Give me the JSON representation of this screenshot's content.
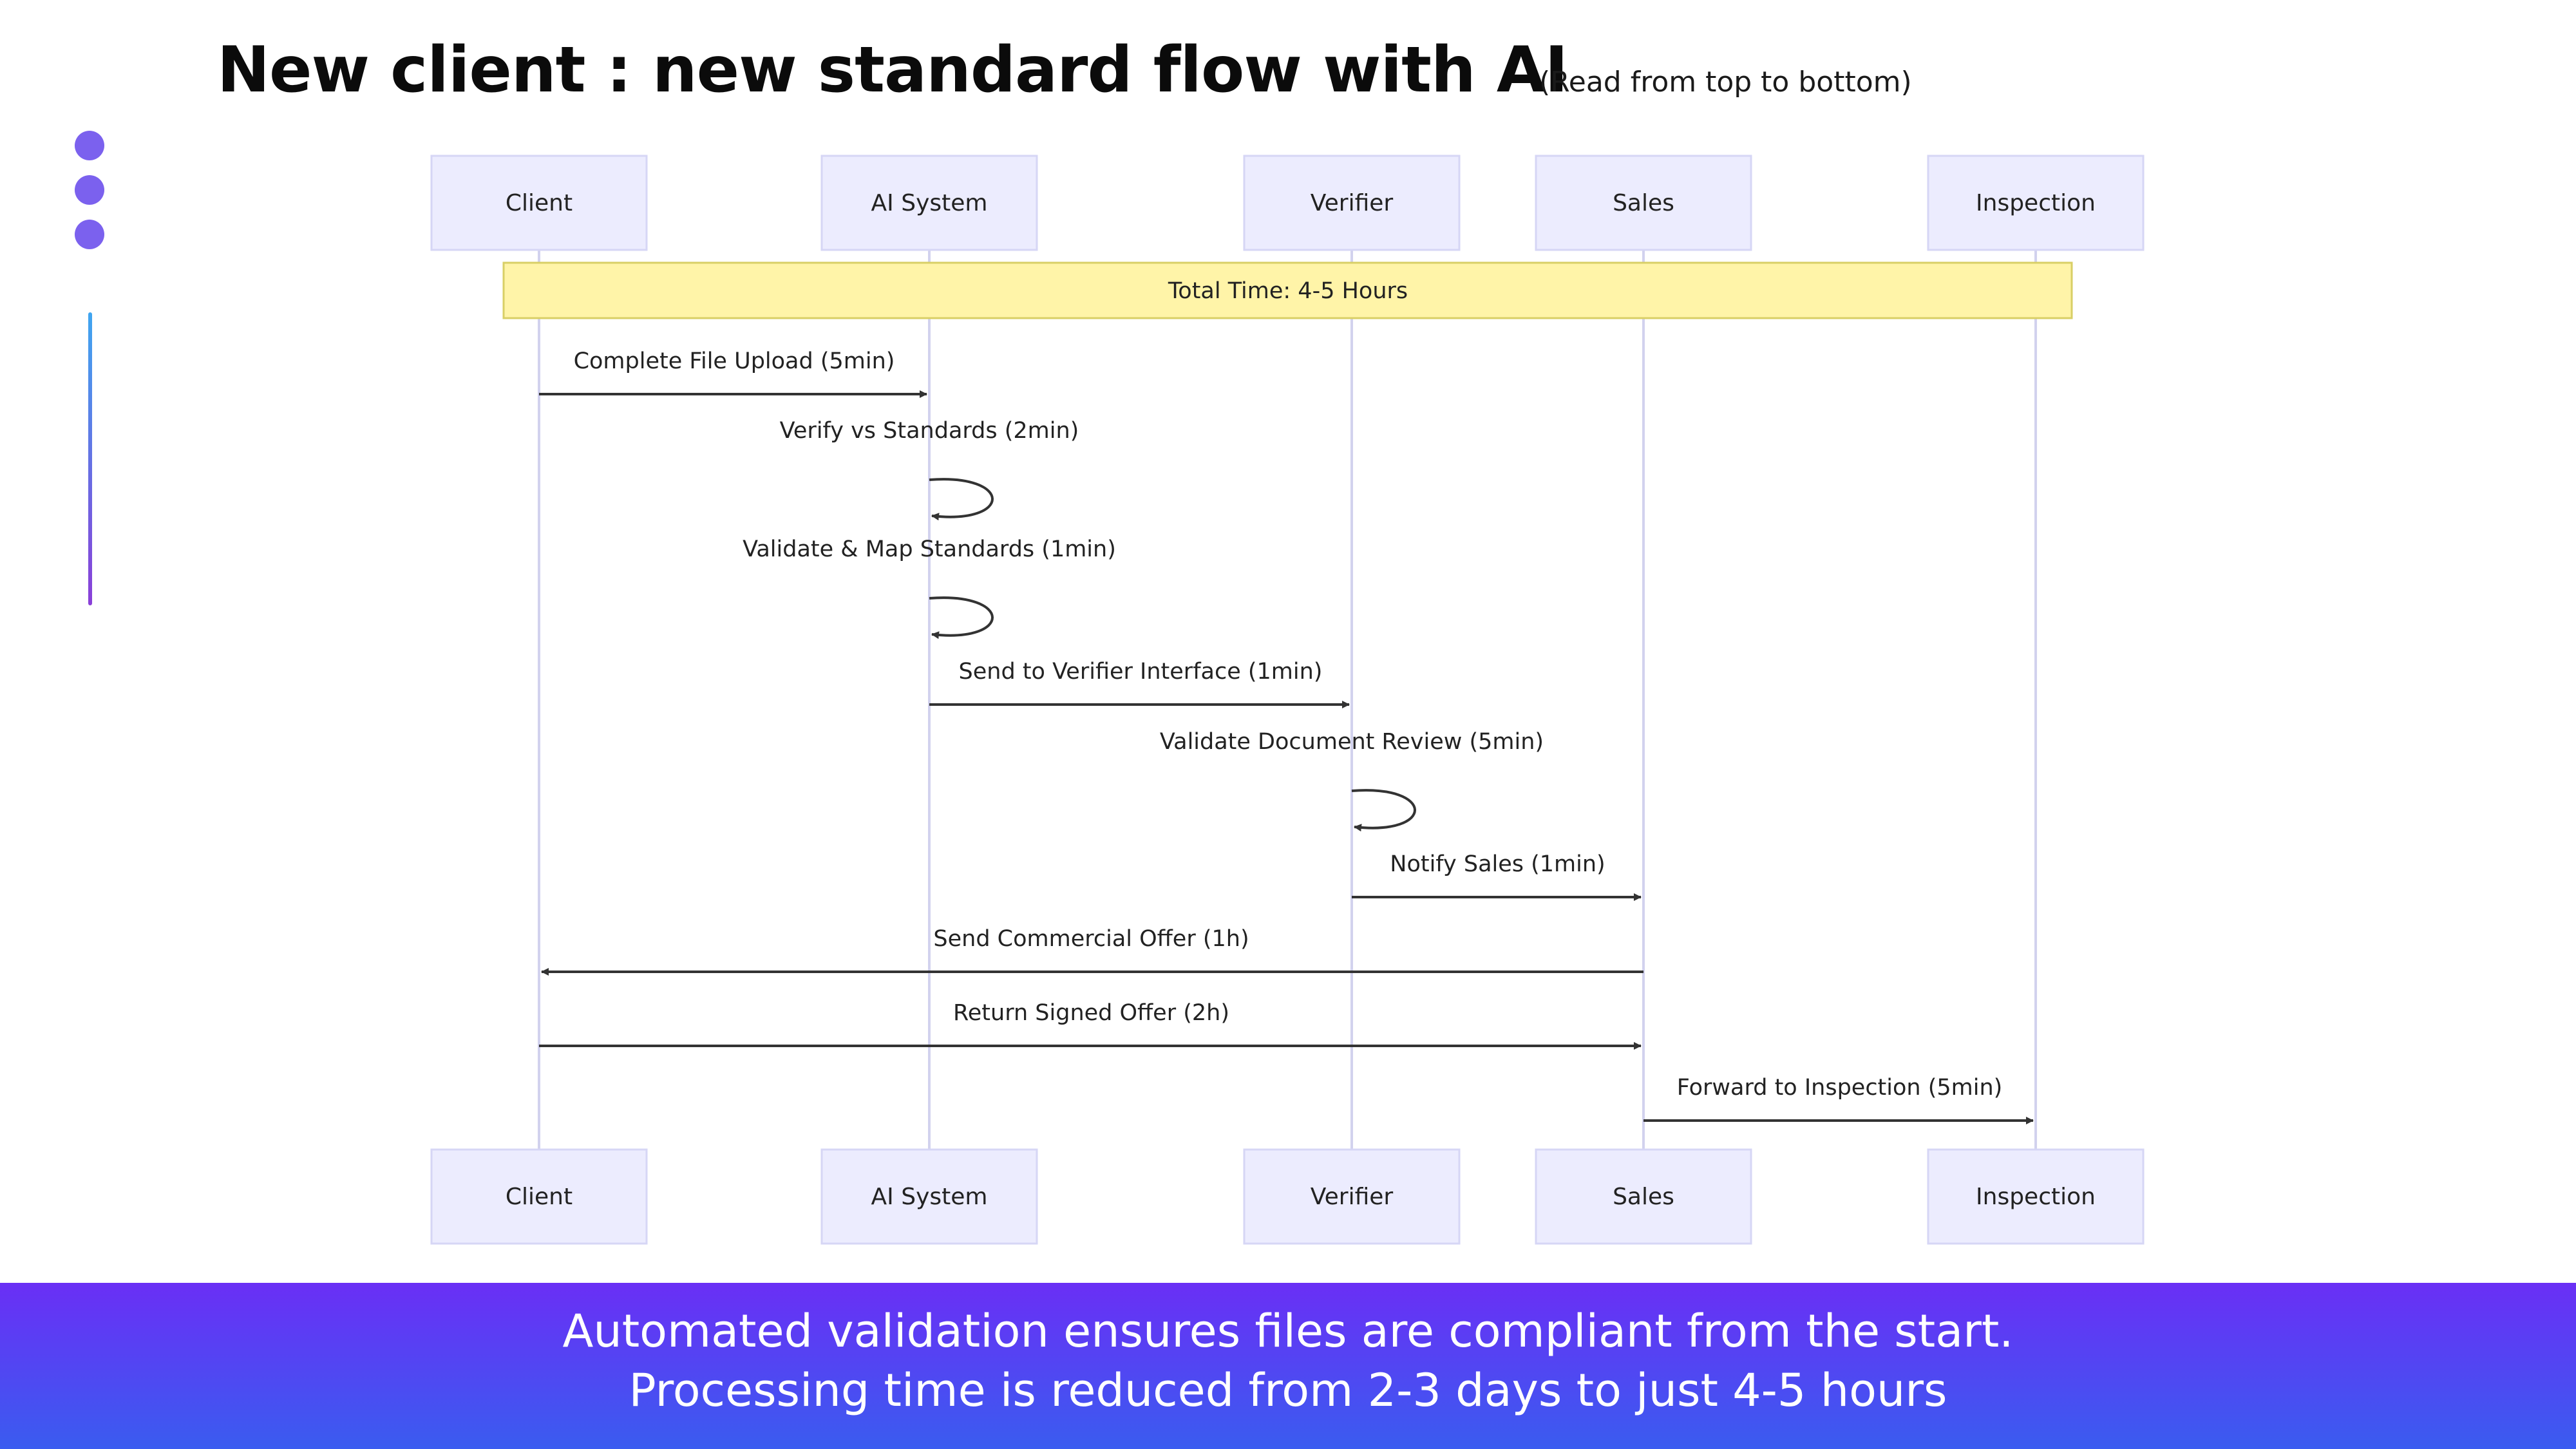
{
  "title": "New client : new standard flow with AI",
  "subtitle": "(Read from top to bottom)",
  "participants": [
    "Client",
    "AI System",
    "Verifier",
    "Sales",
    "Inspection"
  ],
  "note": "Total Time: 4-5 Hours",
  "messages": [
    {
      "from": 0,
      "to": 1,
      "label": "Complete File Upload (5min)"
    },
    {
      "from": 1,
      "to": 1,
      "label": "Verify vs Standards (2min)"
    },
    {
      "from": 1,
      "to": 1,
      "label": "Validate & Map Standards (1min)"
    },
    {
      "from": 1,
      "to": 2,
      "label": "Send to Verifier Interface (1min)"
    },
    {
      "from": 2,
      "to": 2,
      "label": "Validate Document Review (5min)"
    },
    {
      "from": 2,
      "to": 3,
      "label": "Notify Sales (1min)"
    },
    {
      "from": 3,
      "to": 0,
      "label": "Send Commercial Offer (1h)"
    },
    {
      "from": 0,
      "to": 3,
      "label": "Return Signed Offer (2h)"
    },
    {
      "from": 3,
      "to": 4,
      "label": "Forward to Inspection (5min)"
    }
  ],
  "footer": {
    "line1": "Automated validation ensures files are compliant from the start.",
    "line2": "Processing time is reduced from 2-3 days to just 4-5 hours"
  },
  "colors": {
    "dot": "#7b61ee",
    "participant_fill": "#ececfe",
    "participant_stroke": "#d6d6f5",
    "lifeline": "#d2d2ee",
    "note_fill": "#fff4a8",
    "note_stroke": "#d8cf66",
    "arrow": "#333333"
  }
}
